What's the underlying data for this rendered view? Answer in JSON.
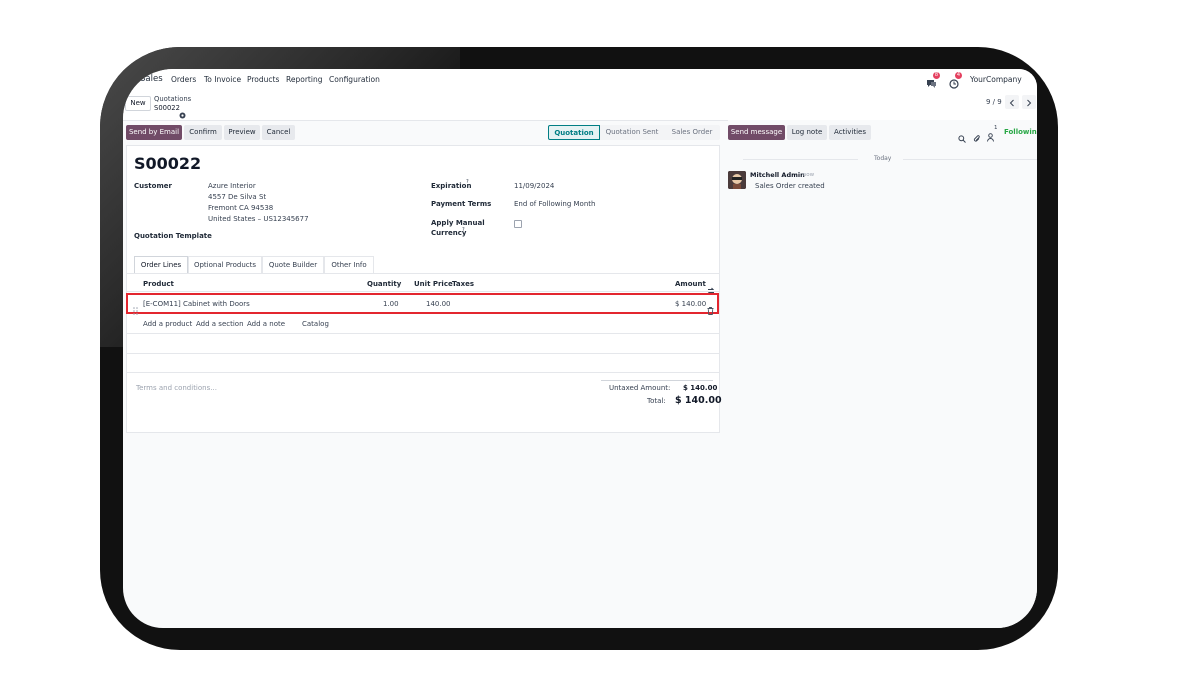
{
  "topnav": {
    "app": "Sales",
    "menu": [
      "Orders",
      "To Invoice",
      "Products",
      "Reporting",
      "Configuration"
    ],
    "company": "YourCompany",
    "chat_badge": "8",
    "activity_badge": "4"
  },
  "control": {
    "new_label": "New",
    "breadcrumb_parent": "Quotations",
    "breadcrumb_current": "S00022",
    "pager": "9 / 9"
  },
  "actions": {
    "send_email": "Send by Email",
    "confirm": "Confirm",
    "preview": "Preview",
    "cancel": "Cancel"
  },
  "status": {
    "stages": [
      "Quotation",
      "Quotation Sent",
      "Sales Order"
    ],
    "active": "Quotation"
  },
  "form": {
    "title": "S00022",
    "customer_label": "Customer",
    "customer_name": "Azure Interior",
    "address_line1": "4557 De Silva St",
    "address_line2": "Fremont CA 94538",
    "address_line3": "United States – US12345677",
    "template_label": "Quotation Template",
    "expiration_label": "Expiration",
    "expiration_value": "11/09/2024",
    "payment_terms_label": "Payment Terms",
    "payment_terms_value": "End of Following Month",
    "currency_label_1": "Apply Manual",
    "currency_label_2": "Currency",
    "help_mark": "?"
  },
  "tabs": [
    "Order Lines",
    "Optional Products",
    "Quote Builder",
    "Other Info"
  ],
  "lines": {
    "headers": {
      "product": "Product",
      "quantity": "Quantity",
      "unit_price": "Unit Price",
      "taxes": "Taxes",
      "amount": "Amount"
    },
    "rows": [
      {
        "product": "[E-COM11] Cabinet with Doors",
        "quantity": "1.00",
        "unit_price": "140.00",
        "amount": "$ 140.00"
      }
    ],
    "add_product": "Add a product",
    "add_section": "Add a section",
    "add_note": "Add a note",
    "catalog": "Catalog"
  },
  "totals": {
    "terms_placeholder": "Terms and conditions...",
    "untaxed_label": "Untaxed Amount:",
    "untaxed_value": "$ 140.00",
    "total_label": "Total:",
    "total_value": "$ 140.00"
  },
  "chatter": {
    "send_message": "Send message",
    "log_note": "Log note",
    "activities": "Activities",
    "followers_count": "1",
    "following": "Following",
    "today": "Today",
    "author": "Mitchell Admin",
    "time": "- now",
    "message": "Sales Order created"
  },
  "colors": {
    "primary": "#714b67",
    "link": "#017e84",
    "highlight": "#e3262f",
    "following": "#28a745",
    "badge": "#e4405f"
  }
}
